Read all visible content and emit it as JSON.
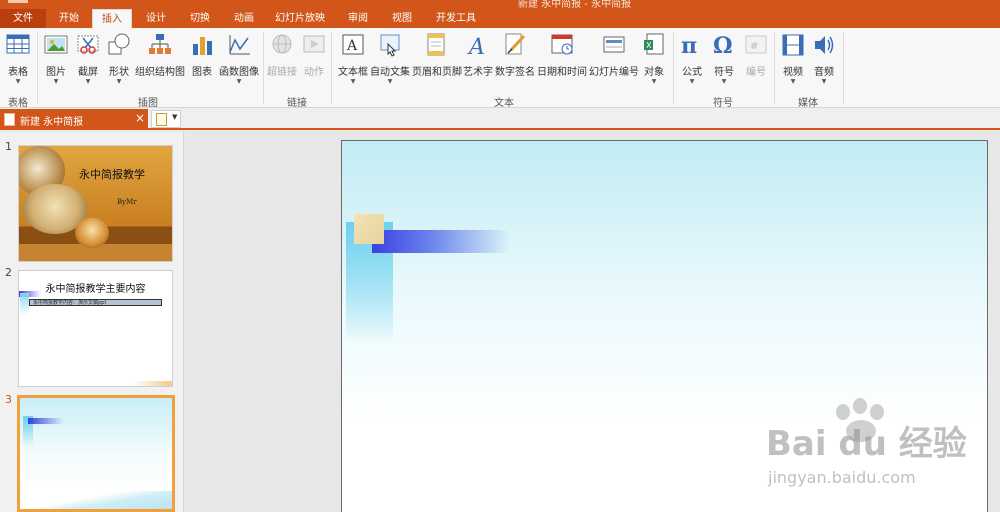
{
  "window": {
    "title": "新建 永中简报 - 永中简报"
  },
  "tabs": [
    {
      "label": "文件"
    },
    {
      "label": "开始"
    },
    {
      "label": "插入",
      "active": true
    },
    {
      "label": "设计"
    },
    {
      "label": "切换"
    },
    {
      "label": "动画"
    },
    {
      "label": "幻灯片放映"
    },
    {
      "label": "审阅"
    },
    {
      "label": "视图"
    },
    {
      "label": "开发工具"
    }
  ],
  "ribbon": {
    "groups": [
      {
        "label": "表格"
      },
      {
        "label": "插图"
      },
      {
        "label": "链接"
      },
      {
        "label": "文本"
      },
      {
        "label": "符号"
      },
      {
        "label": "媒体"
      }
    ],
    "buttons": [
      {
        "label": "表格",
        "icon": "table-icon"
      },
      {
        "label": "图片",
        "icon": "picture-icon"
      },
      {
        "label": "截屏",
        "icon": "screenshot-icon"
      },
      {
        "label": "形状",
        "icon": "shapes-icon"
      },
      {
        "label": "组织结构图",
        "icon": "org-chart-icon"
      },
      {
        "label": "图表",
        "icon": "bar-chart-icon"
      },
      {
        "label": "函数图像",
        "icon": "function-graph-icon"
      },
      {
        "label": "超链接",
        "icon": "hyperlink-icon",
        "disabled": true
      },
      {
        "label": "动作",
        "icon": "action-icon",
        "disabled": true
      },
      {
        "label": "文本框",
        "icon": "textbox-icon"
      },
      {
        "label": "自动文集",
        "icon": "autotext-icon"
      },
      {
        "label": "页眉和页脚",
        "icon": "header-footer-icon"
      },
      {
        "label": "艺术字",
        "icon": "wordart-icon"
      },
      {
        "label": "数字签名",
        "icon": "signature-icon"
      },
      {
        "label": "日期和时间",
        "icon": "date-time-icon"
      },
      {
        "label": "幻灯片编号",
        "icon": "slide-number-icon"
      },
      {
        "label": "对象",
        "icon": "object-icon"
      },
      {
        "label": "公式",
        "icon": "pi-icon"
      },
      {
        "label": "符号",
        "icon": "omega-icon"
      },
      {
        "label": "编号",
        "icon": "numbering-icon",
        "disabled": true
      },
      {
        "label": "视频",
        "icon": "video-icon"
      },
      {
        "label": "音频",
        "icon": "audio-icon"
      }
    ]
  },
  "document_tab": {
    "label": "新建 永中简报",
    "close": "×"
  },
  "new_doc_dropdown": "▼",
  "slides": [
    {
      "number": "1",
      "title": "永中简报教学",
      "subtitle": "ByMr"
    },
    {
      "number": "2",
      "title": "永中简报教学主要内容",
      "bar_text": "永中简报教学内容：演示文稿ppt"
    },
    {
      "number": "3",
      "selected": true
    }
  ],
  "watermark": {
    "brand": "Bai du 经验",
    "url": "jingyan.baidu.com"
  },
  "colors": {
    "accent": "#d2561a",
    "selected_thumb": "#f0a03c"
  }
}
